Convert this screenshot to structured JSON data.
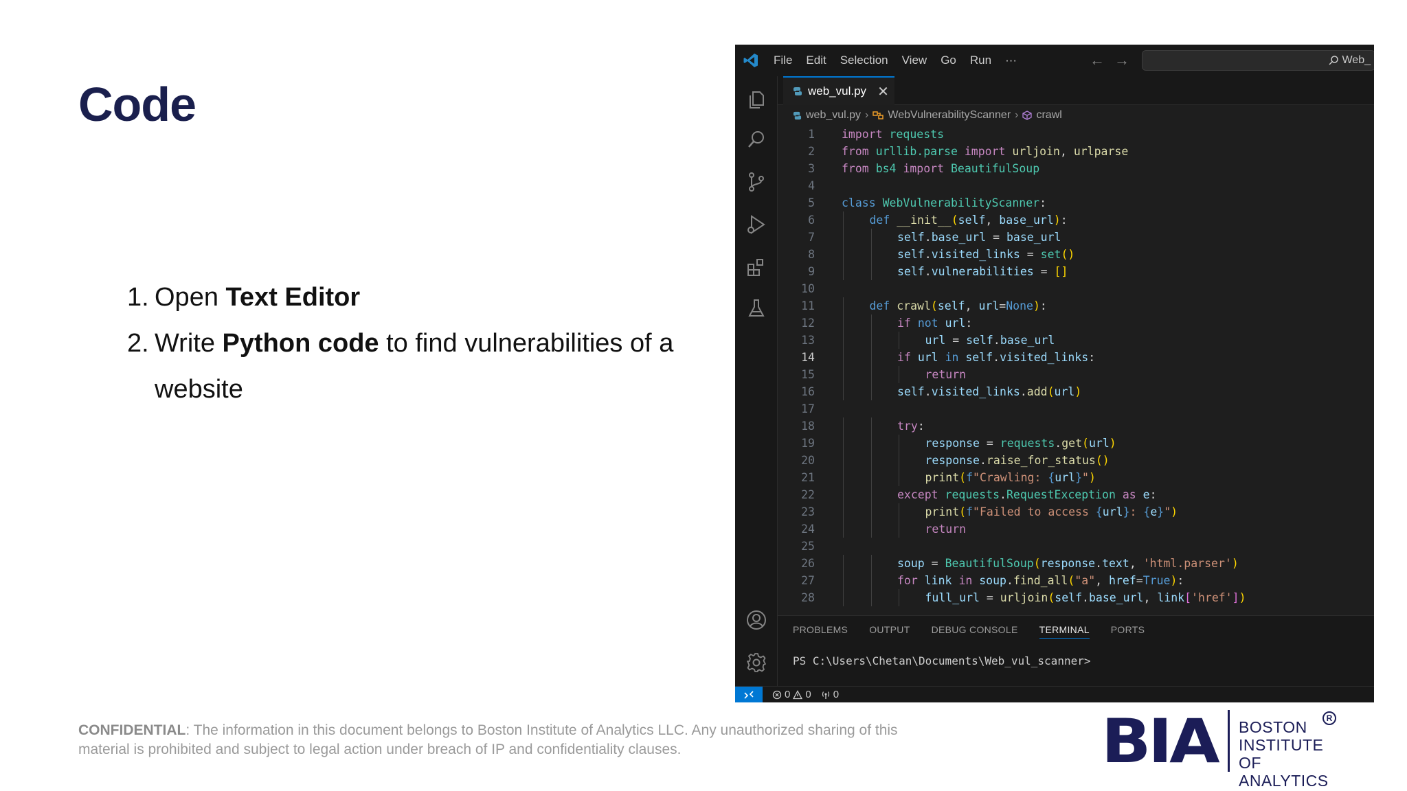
{
  "slide": {
    "title": "Code",
    "steps": [
      {
        "num": "1.",
        "pre": "Open ",
        "bold": "Text Editor",
        "post": ""
      },
      {
        "num": "2.",
        "pre": "Write ",
        "bold": "Python code",
        "post": " to find vulnerabilities of a website"
      }
    ],
    "footer_bold": "CONFIDENTIAL",
    "footer_text": ": The information in this document belongs to Boston Institute of Analytics LLC. Any unauthorized sharing of this material is prohibited and subject to legal action under breach of IP and confidentiality clauses."
  },
  "logo": {
    "mark": "BIA",
    "line1": "BOSTON",
    "line2": "INSTITUTE OF",
    "line3": "ANALYTICS",
    "reg": "R"
  },
  "editor": {
    "menu": [
      "File",
      "Edit",
      "Selection",
      "View",
      "Go",
      "Run",
      "···"
    ],
    "search_text": "Web_",
    "tab_name": "web_vul.py",
    "breadcrumb": [
      "web_vul.py",
      "WebVulnerabilityScanner",
      "crawl"
    ],
    "active_line": 14,
    "panel_tabs": [
      "PROBLEMS",
      "OUTPUT",
      "DEBUG CONSOLE",
      "TERMINAL",
      "PORTS"
    ],
    "active_panel_tab": "TERMINAL",
    "terminal_prompt": "PS C:\\Users\\Chetan\\Documents\\Web_vul_scanner>",
    "status_errors": "0",
    "status_warnings": "0",
    "status_ports": "0",
    "icons": {
      "activity": [
        "explorer-icon",
        "search-icon",
        "source-control-icon",
        "run-debug-icon",
        "extensions-icon",
        "testing-icon",
        "account-icon",
        "settings-gear-icon"
      ]
    }
  },
  "code_lines": [
    {
      "n": 1,
      "indent": 0,
      "toks": [
        [
          "kw",
          "import"
        ],
        [
          "pl",
          " "
        ],
        [
          "mod",
          "requests"
        ]
      ]
    },
    {
      "n": 2,
      "indent": 0,
      "toks": [
        [
          "kw",
          "from"
        ],
        [
          "pl",
          " "
        ],
        [
          "mod",
          "urllib.parse"
        ],
        [
          "pl",
          " "
        ],
        [
          "kw",
          "import"
        ],
        [
          "pl",
          " "
        ],
        [
          "fn",
          "urljoin"
        ],
        [
          "pl",
          ", "
        ],
        [
          "fn",
          "urlparse"
        ]
      ]
    },
    {
      "n": 3,
      "indent": 0,
      "toks": [
        [
          "kw",
          "from"
        ],
        [
          "pl",
          " "
        ],
        [
          "mod",
          "bs4"
        ],
        [
          "pl",
          " "
        ],
        [
          "kw",
          "import"
        ],
        [
          "pl",
          " "
        ],
        [
          "cls",
          "BeautifulSoup"
        ]
      ]
    },
    {
      "n": 4,
      "indent": 0,
      "toks": []
    },
    {
      "n": 5,
      "indent": 0,
      "toks": [
        [
          "kw2",
          "class"
        ],
        [
          "pl",
          " "
        ],
        [
          "cls",
          "WebVulnerabilityScanner"
        ],
        [
          "pl",
          ":"
        ]
      ]
    },
    {
      "n": 6,
      "indent": 1,
      "toks": [
        [
          "kw2",
          "def"
        ],
        [
          "pl",
          " "
        ],
        [
          "fn",
          "__init__"
        ],
        [
          "br",
          "("
        ],
        [
          "var",
          "self"
        ],
        [
          "pl",
          ", "
        ],
        [
          "var",
          "base_url"
        ],
        [
          "br",
          ")"
        ],
        [
          "pl",
          ":"
        ]
      ]
    },
    {
      "n": 7,
      "indent": 2,
      "toks": [
        [
          "var",
          "self"
        ],
        [
          "pl",
          "."
        ],
        [
          "var",
          "base_url"
        ],
        [
          "pl",
          " = "
        ],
        [
          "var",
          "base_url"
        ]
      ]
    },
    {
      "n": 8,
      "indent": 2,
      "toks": [
        [
          "var",
          "self"
        ],
        [
          "pl",
          "."
        ],
        [
          "var",
          "visited_links"
        ],
        [
          "pl",
          " = "
        ],
        [
          "cls",
          "set"
        ],
        [
          "br",
          "()"
        ]
      ]
    },
    {
      "n": 9,
      "indent": 2,
      "toks": [
        [
          "var",
          "self"
        ],
        [
          "pl",
          "."
        ],
        [
          "var",
          "vulnerabilities"
        ],
        [
          "pl",
          " = "
        ],
        [
          "br",
          "[]"
        ]
      ]
    },
    {
      "n": 10,
      "indent": 0,
      "toks": []
    },
    {
      "n": 11,
      "indent": 1,
      "toks": [
        [
          "kw2",
          "def"
        ],
        [
          "pl",
          " "
        ],
        [
          "fn",
          "crawl"
        ],
        [
          "br",
          "("
        ],
        [
          "var",
          "self"
        ],
        [
          "pl",
          ", "
        ],
        [
          "var",
          "url"
        ],
        [
          "pl",
          "="
        ],
        [
          "kw2",
          "None"
        ],
        [
          "br",
          ")"
        ],
        [
          "pl",
          ":"
        ]
      ]
    },
    {
      "n": 12,
      "indent": 2,
      "toks": [
        [
          "kw",
          "if"
        ],
        [
          "pl",
          " "
        ],
        [
          "kw2",
          "not"
        ],
        [
          "pl",
          " "
        ],
        [
          "var",
          "url"
        ],
        [
          "pl",
          ":"
        ]
      ]
    },
    {
      "n": 13,
      "indent": 3,
      "toks": [
        [
          "var",
          "url"
        ],
        [
          "pl",
          " = "
        ],
        [
          "var",
          "self"
        ],
        [
          "pl",
          "."
        ],
        [
          "var",
          "base_url"
        ]
      ]
    },
    {
      "n": 14,
      "indent": 2,
      "toks": [
        [
          "kw",
          "if"
        ],
        [
          "pl",
          " "
        ],
        [
          "var",
          "url"
        ],
        [
          "pl",
          " "
        ],
        [
          "kw2",
          "in"
        ],
        [
          "pl",
          " "
        ],
        [
          "var",
          "self"
        ],
        [
          "pl",
          "."
        ],
        [
          "var",
          "visited_links"
        ],
        [
          "pl",
          ":"
        ]
      ]
    },
    {
      "n": 15,
      "indent": 3,
      "toks": [
        [
          "kw",
          "return"
        ]
      ]
    },
    {
      "n": 16,
      "indent": 2,
      "toks": [
        [
          "var",
          "self"
        ],
        [
          "pl",
          "."
        ],
        [
          "var",
          "visited_links"
        ],
        [
          "pl",
          "."
        ],
        [
          "fn",
          "add"
        ],
        [
          "br",
          "("
        ],
        [
          "var",
          "url"
        ],
        [
          "br",
          ")"
        ]
      ]
    },
    {
      "n": 17,
      "indent": 0,
      "toks": []
    },
    {
      "n": 18,
      "indent": 2,
      "toks": [
        [
          "kw",
          "try"
        ],
        [
          "pl",
          ":"
        ]
      ]
    },
    {
      "n": 19,
      "indent": 3,
      "toks": [
        [
          "var",
          "response"
        ],
        [
          "pl",
          " = "
        ],
        [
          "mod",
          "requests"
        ],
        [
          "pl",
          "."
        ],
        [
          "fn",
          "get"
        ],
        [
          "br",
          "("
        ],
        [
          "var",
          "url"
        ],
        [
          "br",
          ")"
        ]
      ]
    },
    {
      "n": 20,
      "indent": 3,
      "toks": [
        [
          "var",
          "response"
        ],
        [
          "pl",
          "."
        ],
        [
          "fn",
          "raise_for_status"
        ],
        [
          "br",
          "()"
        ]
      ]
    },
    {
      "n": 21,
      "indent": 3,
      "toks": [
        [
          "fn",
          "print"
        ],
        [
          "br",
          "("
        ],
        [
          "kw2",
          "f"
        ],
        [
          "str",
          "\"Crawling: "
        ],
        [
          "kw2",
          "{"
        ],
        [
          "var",
          "url"
        ],
        [
          "kw2",
          "}"
        ],
        [
          "str",
          "\""
        ],
        [
          "br",
          ")"
        ]
      ]
    },
    {
      "n": 22,
      "indent": 2,
      "toks": [
        [
          "kw",
          "except"
        ],
        [
          "pl",
          " "
        ],
        [
          "mod",
          "requests"
        ],
        [
          "pl",
          "."
        ],
        [
          "cls",
          "RequestException"
        ],
        [
          "pl",
          " "
        ],
        [
          "kw",
          "as"
        ],
        [
          "pl",
          " "
        ],
        [
          "var",
          "e"
        ],
        [
          "pl",
          ":"
        ]
      ]
    },
    {
      "n": 23,
      "indent": 3,
      "toks": [
        [
          "fn",
          "print"
        ],
        [
          "br",
          "("
        ],
        [
          "kw2",
          "f"
        ],
        [
          "str",
          "\"Failed to access "
        ],
        [
          "kw2",
          "{"
        ],
        [
          "var",
          "url"
        ],
        [
          "kw2",
          "}"
        ],
        [
          "str",
          ": "
        ],
        [
          "kw2",
          "{"
        ],
        [
          "var",
          "e"
        ],
        [
          "kw2",
          "}"
        ],
        [
          "str",
          "\""
        ],
        [
          "br",
          ")"
        ]
      ]
    },
    {
      "n": 24,
      "indent": 3,
      "toks": [
        [
          "kw",
          "return"
        ]
      ]
    },
    {
      "n": 25,
      "indent": 0,
      "toks": []
    },
    {
      "n": 26,
      "indent": 2,
      "toks": [
        [
          "var",
          "soup"
        ],
        [
          "pl",
          " = "
        ],
        [
          "cls",
          "BeautifulSoup"
        ],
        [
          "br",
          "("
        ],
        [
          "var",
          "response"
        ],
        [
          "pl",
          "."
        ],
        [
          "var",
          "text"
        ],
        [
          "pl",
          ", "
        ],
        [
          "str",
          "'html.parser'"
        ],
        [
          "br",
          ")"
        ]
      ]
    },
    {
      "n": 27,
      "indent": 2,
      "toks": [
        [
          "kw",
          "for"
        ],
        [
          "pl",
          " "
        ],
        [
          "var",
          "link"
        ],
        [
          "pl",
          " "
        ],
        [
          "kw",
          "in"
        ],
        [
          "pl",
          " "
        ],
        [
          "var",
          "soup"
        ],
        [
          "pl",
          "."
        ],
        [
          "fn",
          "find_all"
        ],
        [
          "br",
          "("
        ],
        [
          "str",
          "\"a\""
        ],
        [
          "pl",
          ", "
        ],
        [
          "var",
          "href"
        ],
        [
          "pl",
          "="
        ],
        [
          "kw2",
          "True"
        ],
        [
          "br",
          ")"
        ],
        [
          "pl",
          ":"
        ]
      ]
    },
    {
      "n": 28,
      "indent": 3,
      "toks": [
        [
          "var",
          "full_url"
        ],
        [
          "pl",
          " = "
        ],
        [
          "fn",
          "urljoin"
        ],
        [
          "br",
          "("
        ],
        [
          "var",
          "self"
        ],
        [
          "pl",
          "."
        ],
        [
          "var",
          "base_url"
        ],
        [
          "pl",
          ", "
        ],
        [
          "var",
          "link"
        ],
        [
          "br2",
          "["
        ],
        [
          "str",
          "'href'"
        ],
        [
          "br2",
          "]"
        ],
        [
          "br",
          ")"
        ]
      ]
    }
  ]
}
